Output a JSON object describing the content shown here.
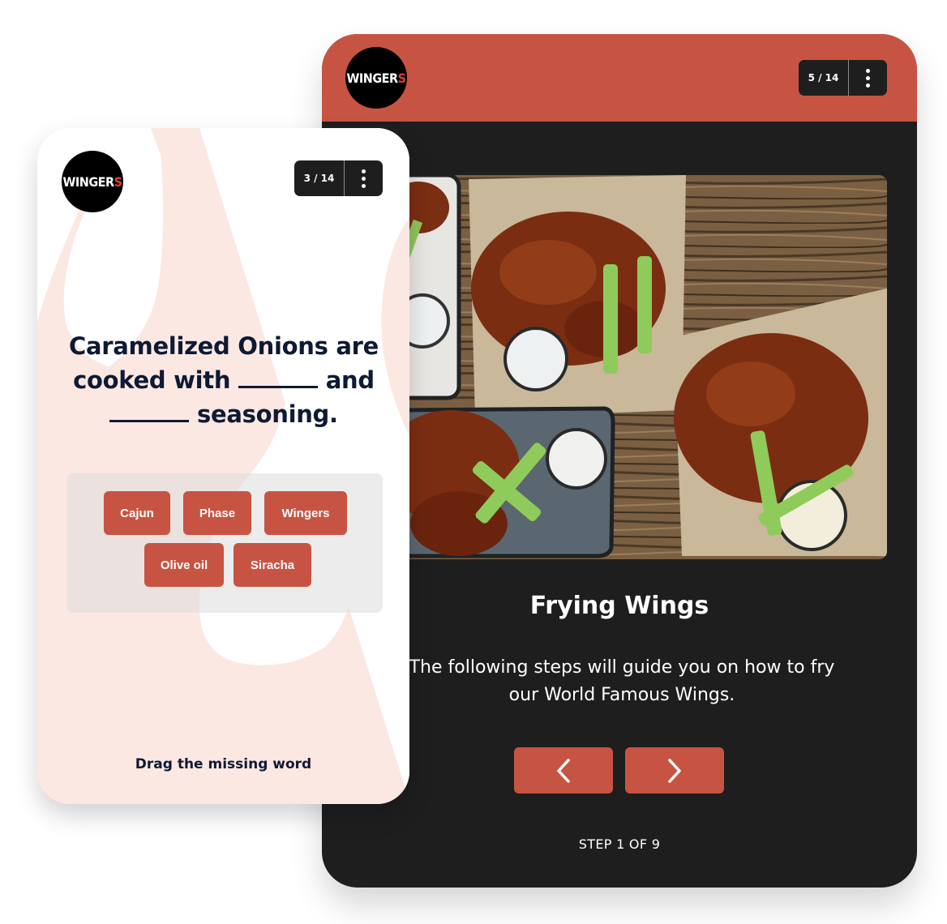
{
  "brand": {
    "logo_main": "WINGER",
    "logo_last": "S",
    "accent_color": "#c75443",
    "dark_color": "#1e1e1e",
    "quiz_bg_color": "#fce8e3"
  },
  "lesson_card": {
    "counter": "5 / 14",
    "menu_icon": "kebab-menu-icon",
    "image_alt": "Plates and baskets of sauced chicken wings with celery sticks and ranch dip on a wooden table",
    "title": "Frying Wings",
    "description": "The following steps will guide you on how to fry our World Famous Wings.",
    "prev_icon": "chevron-left-icon",
    "next_icon": "chevron-right-icon",
    "step_label": "STEP 1 OF 9"
  },
  "quiz_card": {
    "counter": "3 / 14",
    "menu_icon": "kebab-menu-icon",
    "question_parts": [
      "Caramelized Onions are cooked with",
      "and",
      "seasoning."
    ],
    "word_options": [
      "Cajun",
      "Phase",
      "Wingers",
      "Olive oil",
      "Siracha"
    ],
    "instruction": "Drag the missing word"
  }
}
